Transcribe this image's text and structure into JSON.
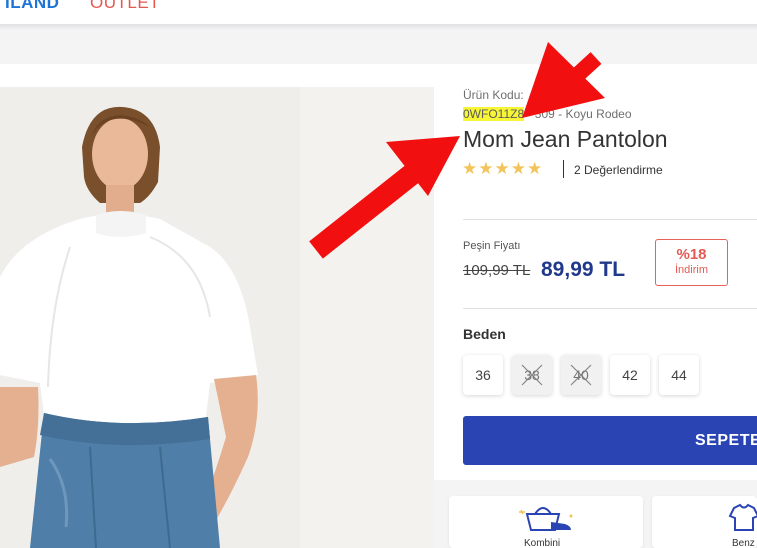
{
  "nav": {
    "item1": "ILAND",
    "item2": "OUTLET"
  },
  "product": {
    "code_label": "Ürün Kodu:",
    "code": "0WFO11Z8",
    "code_suffix": " - 309 - Koyu Rodeo",
    "title": "Mom Jean Pantolon",
    "stars": "★★★★★",
    "rating_text": "2 Değerlendirme",
    "price_label": "Peşin Fiyatı",
    "old_price": "109,99 TL",
    "new_price": "89,99 TL",
    "discount_pct": "%18",
    "discount_label": "İndirim"
  },
  "sizes": {
    "title": "Beden",
    "options": [
      "36",
      "38",
      "40",
      "42",
      "44"
    ],
    "out_of_stock": [
      "38",
      "40"
    ]
  },
  "cart": {
    "label": "SEPETE"
  },
  "tiles": {
    "kombini": "Kombini",
    "benzer": "Benz"
  },
  "colors": {
    "brand_blue": "#2a44b4",
    "price_blue": "#20398b",
    "discount_red": "#e45a52",
    "highlight": "#f7f536",
    "arrow_red": "#f20f0f",
    "star_gold": "#f2c45a"
  },
  "icons": [
    "basket-shoe-icon",
    "tshirt-icon",
    "strike-icon",
    "annotation-arrow-icon"
  ]
}
